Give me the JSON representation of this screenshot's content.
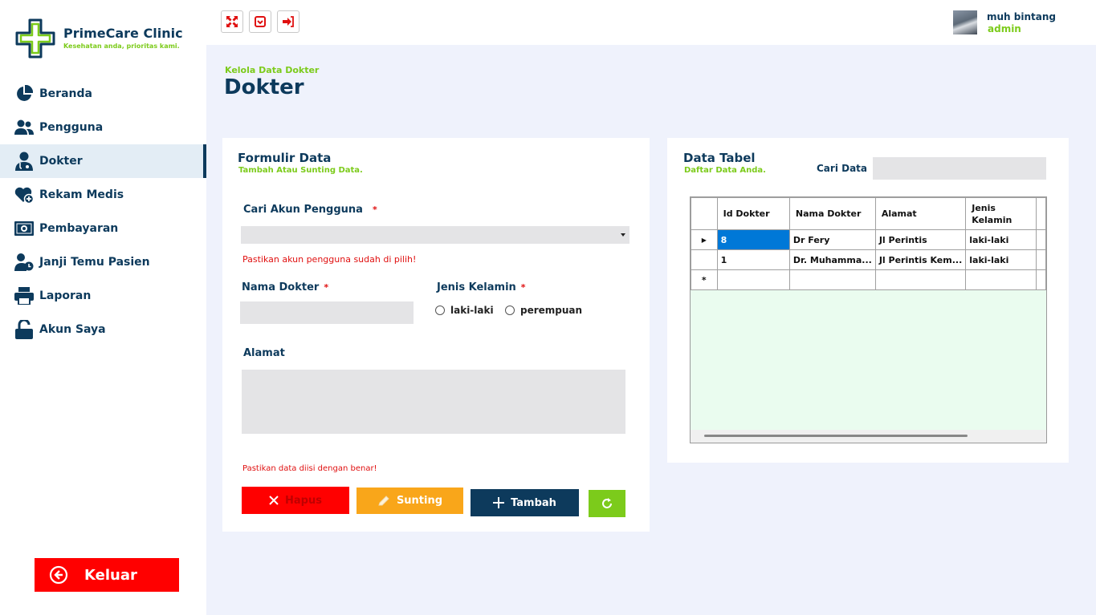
{
  "app": {
    "title": "PrimeCare Clinic",
    "tagline": "Kesehatan anda, prioritas kami."
  },
  "sidebar": {
    "items": [
      {
        "label": "Beranda",
        "icon": "pie-chart-icon",
        "active": false
      },
      {
        "label": "Pengguna",
        "icon": "users-icon",
        "active": false
      },
      {
        "label": "Dokter",
        "icon": "doctor-icon",
        "active": true
      },
      {
        "label": "Rekam Medis",
        "icon": "heart-plus-icon",
        "active": false
      },
      {
        "label": "Pembayaran",
        "icon": "money-icon",
        "active": false
      },
      {
        "label": "Janji Temu Pasien",
        "icon": "user-clock-icon",
        "active": false
      },
      {
        "label": "Laporan",
        "icon": "printer-icon",
        "active": false
      },
      {
        "label": "Akun Saya",
        "icon": "unlock-icon",
        "active": false
      }
    ],
    "logout_label": "Keluar"
  },
  "topbar": {
    "buttons": [
      "fullscreen-icon",
      "minimize-icon",
      "exit-icon"
    ],
    "user_name": "muh bintang",
    "user_role": "admin"
  },
  "header": {
    "breadcrumb": "Kelola Data Dokter",
    "title": "Dokter"
  },
  "form": {
    "title": "Formulir Data",
    "subtitle": "Tambah Atau Sunting Data.",
    "search_account_label": "Cari Akun Pengguna",
    "required_mark": "*",
    "search_account_value": "",
    "search_account_warning": "Pastikan akun pengguna sudah di pilih!",
    "doctor_name_label": "Nama Dokter",
    "doctor_name_value": "",
    "gender_label": "Jenis Kelamin",
    "gender_options": [
      "laki-laki",
      "perempuan"
    ],
    "address_label": "Alamat",
    "address_value": "",
    "data_warning": "Pastikan data diisi dengan benar!",
    "buttons": {
      "delete": "Hapus",
      "edit": "Sunting",
      "add": "Tambah"
    },
    "colors": {
      "delete": "#ff0000",
      "edit": "#f9a61a",
      "add": "#0d3a5c",
      "refresh": "#7ccb1b"
    }
  },
  "table_panel": {
    "title": "Data Tabel",
    "subtitle": "Daftar Data Anda.",
    "search_label": "Cari Data",
    "search_value": "",
    "columns": [
      "Id Dokter",
      "Nama Dokter",
      "Alamat",
      "Jenis Kelamin"
    ],
    "rows": [
      {
        "marker": "▶",
        "id": "8",
        "name": "Dr Fery",
        "address": "Jl Perintis",
        "gender": "laki-laki"
      },
      {
        "marker": "",
        "id": "1",
        "name": "Dr. Muhamma...",
        "address": "Jl Perintis Kem...",
        "gender": "laki-laki"
      },
      {
        "marker": "*",
        "id": "",
        "name": "",
        "address": "",
        "gender": ""
      }
    ]
  },
  "theme": {
    "primary": "#0d3a5c",
    "accent_green": "#7ccb1b",
    "danger": "#ff0000"
  }
}
